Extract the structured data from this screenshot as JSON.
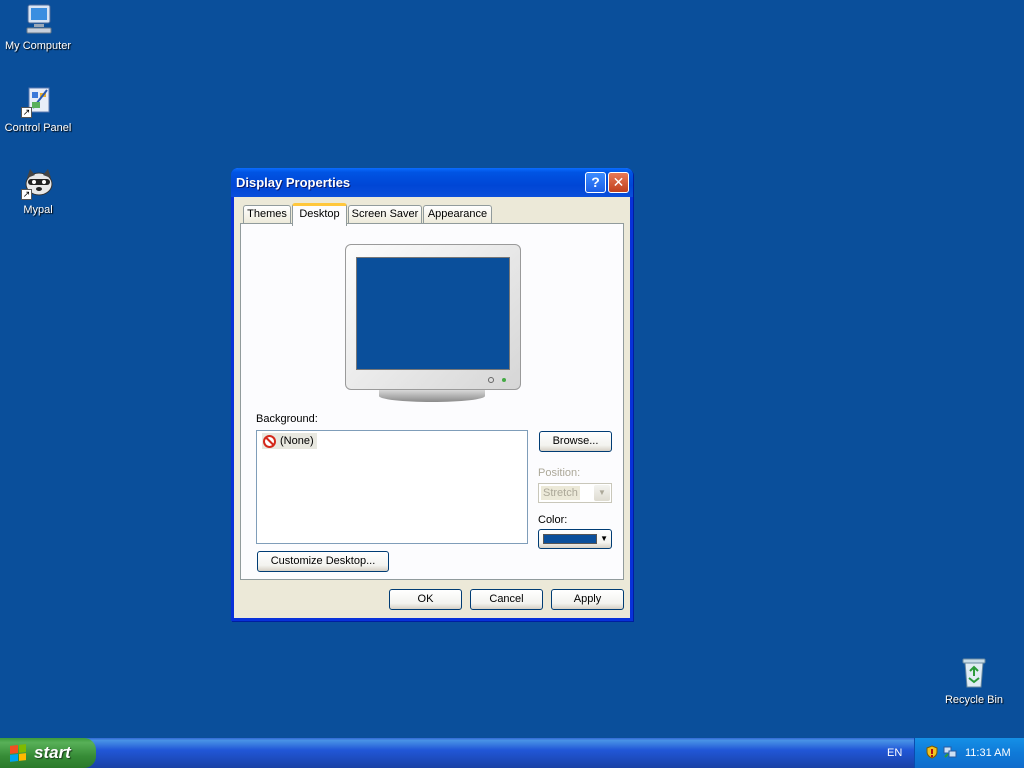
{
  "desktop": {
    "icons": [
      {
        "label": "My Computer"
      },
      {
        "label": "Control Panel"
      },
      {
        "label": "Mypal"
      },
      {
        "label": "Recycle Bin"
      }
    ],
    "background_color": "#0a4f9b"
  },
  "dialog": {
    "title": "Display Properties",
    "help_button": "?",
    "close_button": "✕",
    "tabs": [
      "Themes",
      "Desktop",
      "Screen Saver",
      "Appearance"
    ],
    "active_tab": "Desktop",
    "background_label": "Background:",
    "background_items": [
      "(None)"
    ],
    "browse_button": "Browse...",
    "position_label": "Position:",
    "position_value": "Stretch",
    "color_label": "Color:",
    "color_value": "#0a4f9b",
    "customize_button": "Customize Desktop...",
    "ok_button": "OK",
    "cancel_button": "Cancel",
    "apply_button": "Apply"
  },
  "taskbar": {
    "start_label": "start",
    "language": "EN",
    "clock": "11:31 AM"
  }
}
